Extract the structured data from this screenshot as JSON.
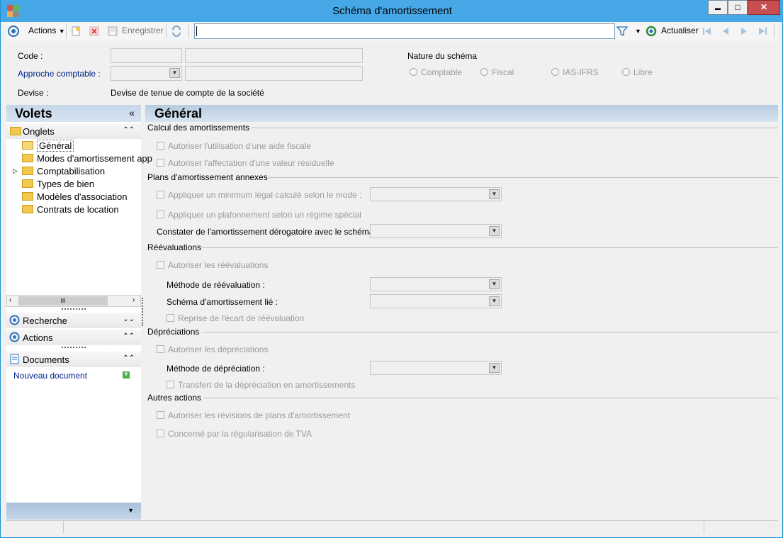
{
  "window": {
    "title": "Schéma d'amortissement",
    "minimize_glyph": "▬",
    "maximize_glyph": "□",
    "close_glyph": "✕"
  },
  "toolbar": {
    "actions_label": "Actions",
    "save_label": "Enregistrer",
    "refresh_label": "Actualiser",
    "search_value": "",
    "icons": [
      "gear-circle-icon",
      "new-doc-icon",
      "delete-icon",
      "save-icon",
      "sync-icon",
      "filter-icon",
      "refresh-icon",
      "first-page-icon",
      "prev-page-icon",
      "next-page-icon",
      "last-page-icon"
    ]
  },
  "header": {
    "code_label": "Code :",
    "approche_label": "Approche comptable :",
    "devise_label": "Devise :",
    "devise_value": "Devise de tenue de compte de la société",
    "nature_label": "Nature du schéma",
    "nature_options": [
      "Comptable",
      "Fiscal",
      "IAS-IFRS",
      "Libre"
    ]
  },
  "left": {
    "volets_title": "Volets",
    "collapse_glyph": "«",
    "onglets_title": "Onglets",
    "tree": [
      "Général",
      "Modes d'amortissement app",
      "Comptabilisation",
      "Types de bien",
      "Modèles d'association",
      "Contrats de location"
    ],
    "scroll_thumb": "III",
    "recherche_title": "Recherche",
    "actions_title": "Actions",
    "documents_title": "Documents",
    "new_document": "Nouveau document"
  },
  "main": {
    "title": "Général",
    "calcul": {
      "title": "Calcul des amortissements",
      "aide_fiscale": "Autoriser l'utilisation d'une aide fiscale",
      "valeur_residuelle": "Autoriser l'affectation d'une valeur résiduelle"
    },
    "plans": {
      "title": "Plans d'amortissement annexes",
      "minimum_legal": "Appliquer un minimum légal calculé selon le mode :",
      "plafonnement": "Appliquer un plafonnement selon un régime spécial",
      "derogatoire": "Constater de l'amortissement dérogatoire avec le schéma :"
    },
    "reevaluations": {
      "title": "Réévaluations",
      "autoriser": "Autoriser les réévaluations",
      "methode": "Méthode de réévaluation :",
      "schema_lie": "Schéma d'amortissement lié :",
      "reprise": "Reprise de l'écart de réévaluation"
    },
    "depreciations": {
      "title": "Dépréciations",
      "autoriser": "Autoriser les dépréciations",
      "methode": "Méthode de dépréciation :",
      "transfert": "Transfert de la dépréciation en amortissements"
    },
    "autres": {
      "title": "Autres actions",
      "revisions": "Autoriser les révisions de plans d'amortissement",
      "tva": "Concerné par la régularisation de TVA"
    }
  },
  "colors": {
    "titlebar": "#46a8e6",
    "pane_header": "#c5d6e8",
    "link": "#00248a",
    "disabled_text": "#9a9a9a"
  }
}
